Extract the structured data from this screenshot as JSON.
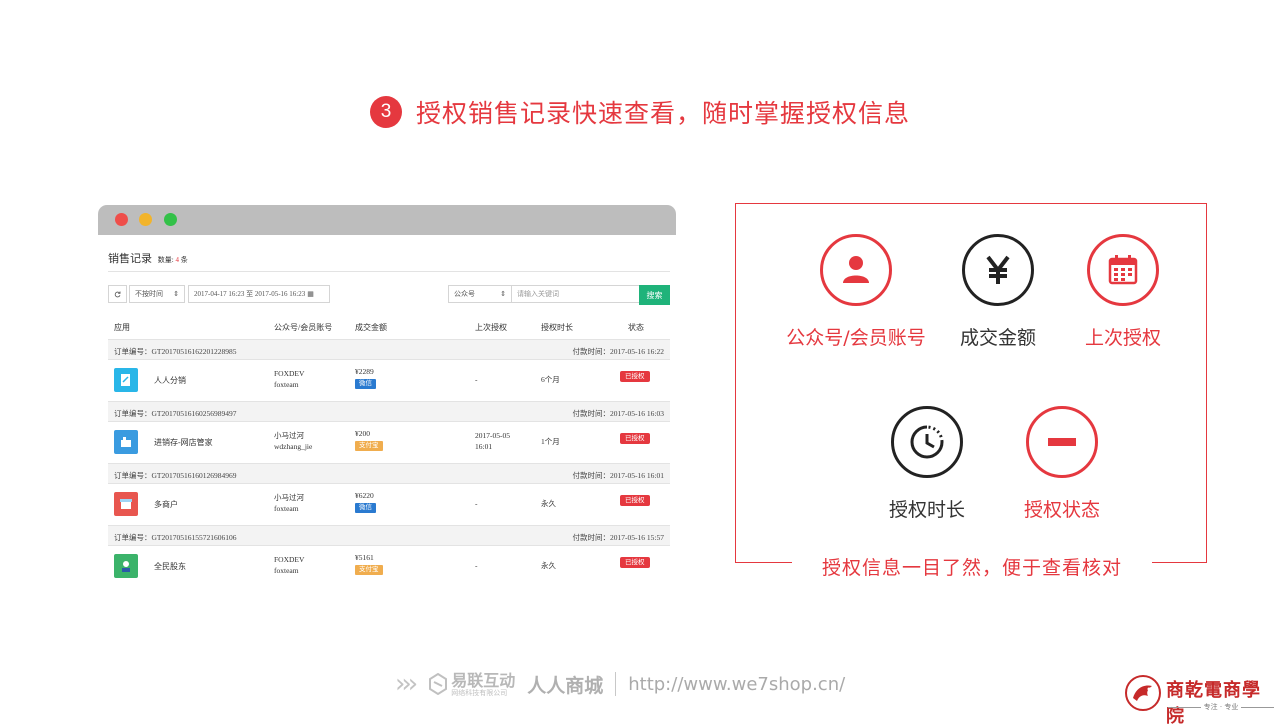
{
  "title": {
    "step": "3",
    "text": "授权销售记录快速查看，随时掌握授权信息"
  },
  "window": {
    "record_title": "销售记录",
    "count_label": "数量:",
    "count_value": "4",
    "count_unit": "条",
    "filter": {
      "time_select": "不按时间",
      "date_range_start": "2017-04-17 16:23",
      "date_range_to": "至",
      "date_range_end": "2017-05-16 16:23",
      "type_select": "公众号",
      "search_placeholder": "请输入关键词",
      "search_button": "搜索"
    },
    "columns": [
      "应用",
      "公众号/会员账号",
      "成交金额",
      "上次授权",
      "授权时长",
      "状态"
    ],
    "orders": [
      {
        "order_label": "订单编号：",
        "order_no": "GT20170516162201228985",
        "paid_label": "付款时间：",
        "paid_time": "2017-05-16 16:22",
        "app": "人人分销",
        "icon_color": "#29b6e8",
        "acct_line1": "FOXDEV",
        "acct_line2": "foxteam",
        "amount": "¥2289",
        "pay": "微信",
        "pay_type": "wx",
        "last_line1": "-",
        "last_line2": "",
        "duration": "6个月",
        "status": "已授权"
      },
      {
        "order_label": "订单编号：",
        "order_no": "GT20170516160256989497",
        "paid_label": "付款时间：",
        "paid_time": "2017-05-16 16:03",
        "app": "进销存-网店管家",
        "icon_color": "#3a9be0",
        "acct_line1": "小马过河",
        "acct_line2": "wdzhang_jie",
        "amount": "¥200",
        "pay": "支付宝",
        "pay_type": "zfb",
        "last_line1": "2017-05-05",
        "last_line2": "16:01",
        "duration": "1个月",
        "status": "已授权"
      },
      {
        "order_label": "订单编号：",
        "order_no": "GT20170516160126984969",
        "paid_label": "付款时间：",
        "paid_time": "2017-05-16 16:01",
        "app": "多商户",
        "icon_color": "#e8564f",
        "acct_line1": "小马过河",
        "acct_line2": "foxteam",
        "amount": "¥6220",
        "pay": "微信",
        "pay_type": "wx",
        "last_line1": "-",
        "last_line2": "",
        "duration": "永久",
        "status": "已授权"
      },
      {
        "order_label": "订单编号：",
        "order_no": "GT20170516155721606106",
        "paid_label": "付款时间：",
        "paid_time": "2017-05-16 15:57",
        "app": "全民股东",
        "icon_color": "#3bb36a",
        "acct_line1": "FOXDEV",
        "acct_line2": "foxteam",
        "amount": "¥5161",
        "pay": "支付宝",
        "pay_type": "zfb",
        "last_line1": "-",
        "last_line2": "",
        "duration": "永久",
        "status": "已授权"
      }
    ]
  },
  "panel": {
    "features": [
      {
        "label": "公众号/会员账号",
        "icon": "user-icon",
        "tone": "red"
      },
      {
        "label": "成交金额",
        "icon": "yen-icon",
        "tone": "dark"
      },
      {
        "label": "上次授权",
        "icon": "calendar-icon",
        "tone": "red"
      },
      {
        "label": "授权时长",
        "icon": "clock-icon",
        "tone": "dark"
      },
      {
        "label": "授权状态",
        "icon": "minus-icon",
        "tone": "red"
      }
    ],
    "caption": "授权信息一目了然，便于查看核对"
  },
  "footer": {
    "arrows": "›››",
    "brand1": "易联互动",
    "brand1_sub": "网络科技有限公司",
    "brand2": "人人商城",
    "url": "http://www.we7shop.cn/"
  },
  "logo": {
    "name": "商乾電商學院",
    "tagline": "专注 · 专业"
  },
  "colors": {
    "accent": "#e5383f",
    "wechat": "#2a7ad0",
    "alipay": "#f0ad4e",
    "search": "#1fb37a"
  }
}
